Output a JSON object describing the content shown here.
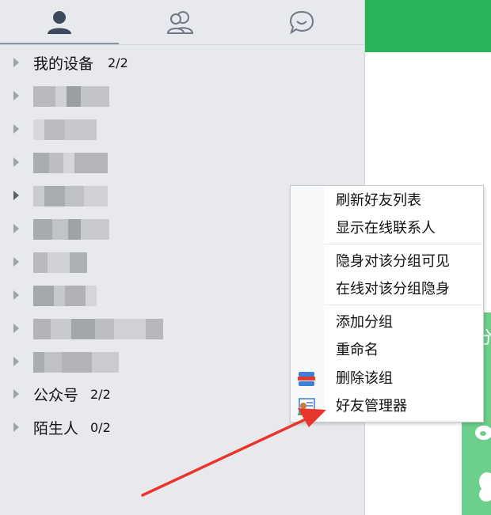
{
  "tabs": [
    {
      "name": "contacts-tab",
      "icon": "person-icon"
    },
    {
      "name": "groups-tab",
      "icon": "people-icon"
    },
    {
      "name": "chat-tab",
      "icon": "chat-bubble-icon"
    }
  ],
  "groups": {
    "my_devices": {
      "label": "我的设备",
      "count": "2/2"
    },
    "official_accounts": {
      "label": "公众号",
      "count": "2/2"
    },
    "strangers": {
      "label": "陌生人",
      "count": "0/2"
    }
  },
  "context_menu": {
    "refresh": "刷新好友列表",
    "show_online": "显示在线联系人",
    "invisible_to_group": "隐身对该分组可见",
    "online_invisible_to_group": "在线对该分组隐身",
    "add_group": "添加分组",
    "rename": "重命名",
    "delete_group": "删除该组",
    "friend_manager": "好友管理器"
  },
  "right_panel": {
    "partial_char": "分"
  },
  "colors": {
    "panel_bg": "#e7e9ed",
    "accent_green": "#2bb359",
    "light_green": "#6ccf8b",
    "arrow_red": "#e8362d"
  }
}
